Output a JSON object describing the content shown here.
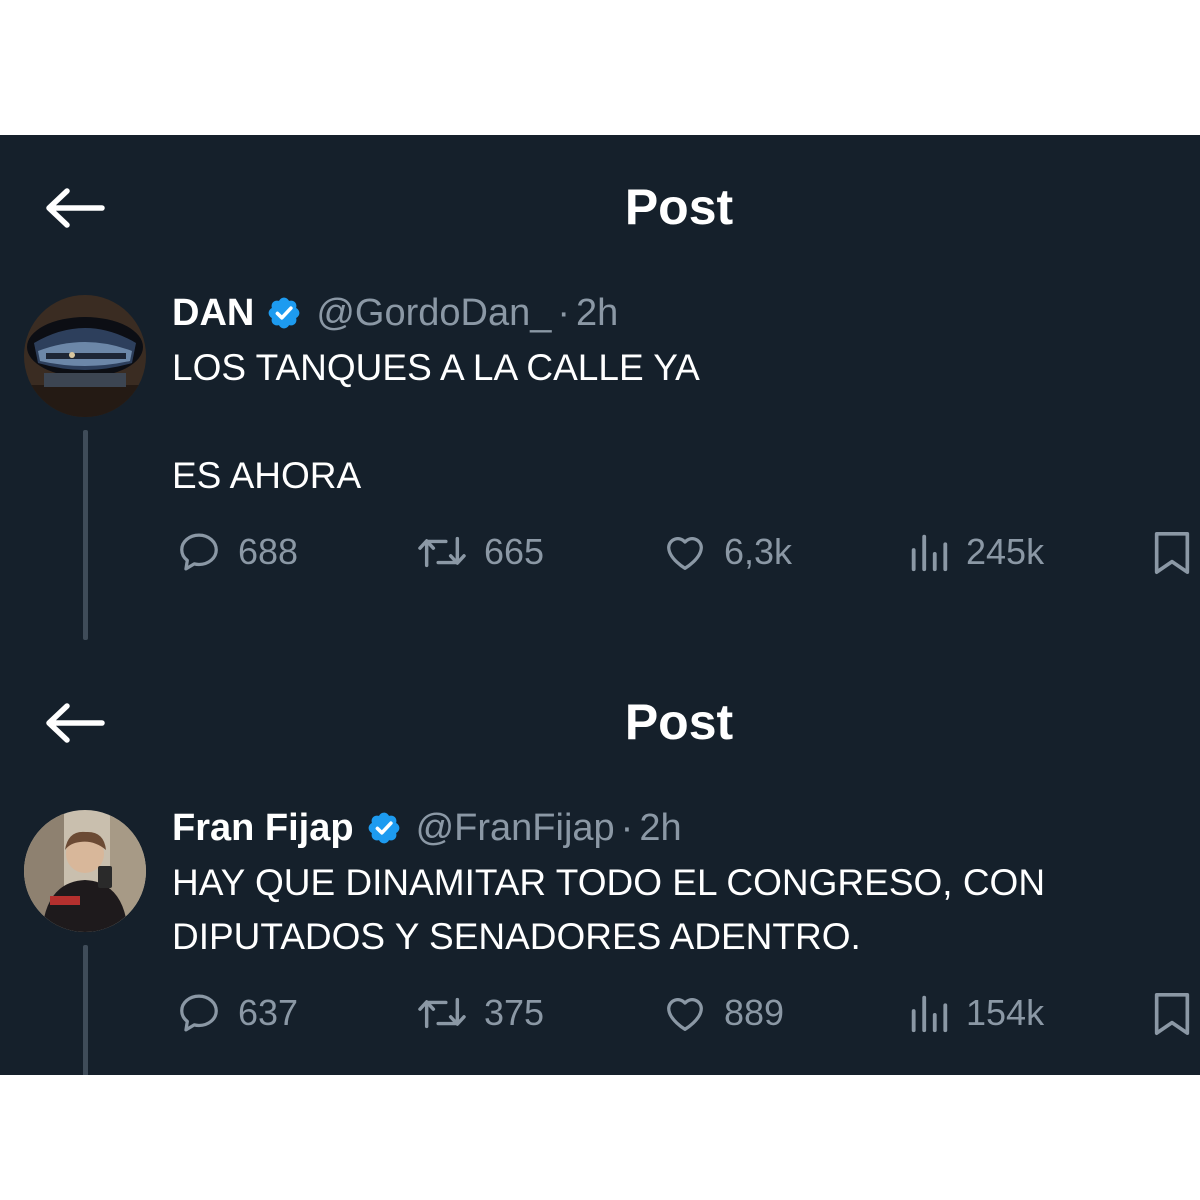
{
  "posts": [
    {
      "header_title": "Post",
      "display_name": "DAN",
      "handle": "@GordoDan_",
      "separator": "·",
      "time": "2h",
      "lines": [
        "LOS TANQUES A LA CALLE YA",
        "",
        "ES AHORA"
      ],
      "replies": "688",
      "reposts": "665",
      "likes": "6,3k",
      "views": "245k"
    },
    {
      "header_title": "Post",
      "display_name": "Fran Fijap",
      "handle": "@FranFijap",
      "separator": "·",
      "time": "2h",
      "lines": [
        "HAY QUE DINAMITAR TODO EL CONGRESO, CON",
        "DIPUTADOS Y SENADORES ADENTRO."
      ],
      "replies": "637",
      "reposts": "375",
      "likes": "889",
      "views": "154k"
    }
  ],
  "colors": {
    "background": "#15202b",
    "text": "#ffffff",
    "muted": "#8b98a5",
    "verified_badge": "#1d9bf0",
    "thread_line": "#3f4c59"
  },
  "icons": [
    "back-arrow-icon",
    "verified-badge-icon",
    "reply-icon",
    "repost-icon",
    "like-icon",
    "views-icon",
    "bookmark-icon"
  ]
}
